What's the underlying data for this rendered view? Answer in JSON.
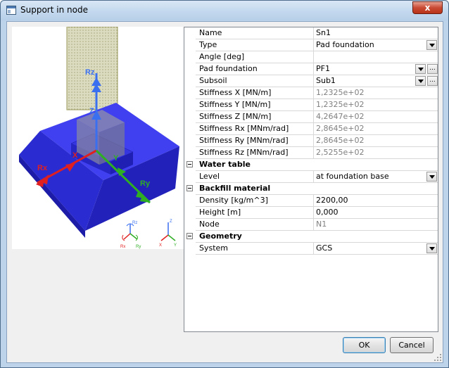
{
  "window": {
    "title": "Support in node",
    "close_label": "x"
  },
  "colors": {
    "foundation": "#3434e8",
    "column": "#bdbd8a",
    "axis_x": "#dd2222",
    "axis_y": "#33aa22",
    "axis_z": "#3366dd"
  },
  "viewport": {
    "axis_labels": {
      "rz": "Rz",
      "z": "Z",
      "x": "X",
      "rx": "Rx",
      "y": "Y",
      "ry": "Ry"
    },
    "mini_triad_left": {
      "rz": "Rz",
      "rx": "Rx",
      "ry": "Ry"
    },
    "mini_triad_right": {
      "z": "Z",
      "x": "X",
      "y": "Y"
    }
  },
  "properties": {
    "name": {
      "label": "Name",
      "value": "Sn1"
    },
    "type": {
      "label": "Type",
      "value": "Pad foundation"
    },
    "angle": {
      "label": "Angle [deg]",
      "value": ""
    },
    "pad_foundation": {
      "label": "Pad foundation",
      "value": "PF1",
      "ellipsis": "..."
    },
    "subsoil": {
      "label": "Subsoil",
      "value": "Sub1",
      "ellipsis": "..."
    },
    "stiffness_x": {
      "label": "Stiffness X [MN/m]",
      "value": "1,2325e+02"
    },
    "stiffness_y": {
      "label": "Stiffness Y [MN/m]",
      "value": "1,2325e+02"
    },
    "stiffness_z": {
      "label": "Stiffness Z [MN/m]",
      "value": "4,2647e+02"
    },
    "stiffness_rx": {
      "label": "Stiffness Rx [MNm/rad]",
      "value": "2,8645e+02"
    },
    "stiffness_ry": {
      "label": "Stiffness Ry [MNm/rad]",
      "value": "2,8645e+02"
    },
    "stiffness_rz": {
      "label": "Stiffness Rz [MNm/rad]",
      "value": "2,5255e+02"
    },
    "water_table": {
      "category": "Water table",
      "level_label": "Level",
      "level_value": "at foundation base"
    },
    "backfill": {
      "category": "Backfill material",
      "density_label": "Density [kg/m^3]",
      "density_value": "2200,00",
      "height_label": "Height [m]",
      "height_value": "0,000",
      "node_label": "Node",
      "node_value": "N1"
    },
    "geometry": {
      "category": "Geometry",
      "system_label": "System",
      "system_value": "GCS"
    }
  },
  "buttons": {
    "ok": "OK",
    "cancel": "Cancel"
  }
}
